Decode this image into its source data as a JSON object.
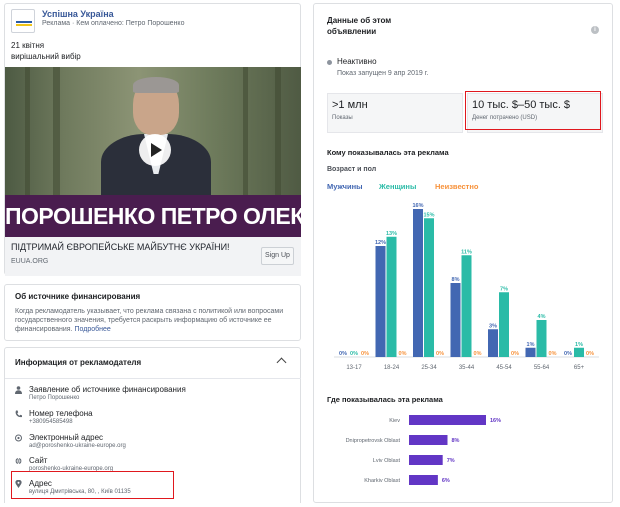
{
  "ad": {
    "page_name": "Успішна Україна",
    "sponsor_line": "Реклама · Кем оплачено: Петро Порошенко",
    "text_line1": "21 квітня",
    "text_line2": "вирішальний вибір",
    "image_banner": "ПОРОШЕНКО ПЕТРО ОЛЕКСІЙОВИЧ",
    "headline": "ПІДТРИМАЙ ЄВРОПЕЙСЬКЕ МАЙБУТНЄ УКРАЇНИ!",
    "domain": "EUUA.ORG",
    "cta_label": "Sign Up"
  },
  "funding": {
    "title": "Об источнике финансирования",
    "body": "Когда рекламодатель указывает, что реклама связана с политикой или вопросами государственного значения, требуется раскрыть информацию об источнике ее финансирования.",
    "link": "Подробнее"
  },
  "advertiser": {
    "title": "Информация от рекламодателя",
    "items": [
      {
        "icon": "person-icon",
        "label": "Заявление об источнике финансирования",
        "value": "Петро Порошенко"
      },
      {
        "icon": "phone-icon",
        "label": "Номер телефона",
        "value": "+380954585498"
      },
      {
        "icon": "email-icon",
        "label": "Электронный адрес",
        "value": "ad@poroshenko-ukraine-europe.org"
      },
      {
        "icon": "globe-icon",
        "label": "Сайт",
        "value": "poroshenko-ukraine-europe.org"
      },
      {
        "icon": "location-pin-icon",
        "label": "Адрес",
        "value": "вулиця Дмитрівська, 80, , Київ 01135"
      }
    ]
  },
  "info": {
    "title_line1": "Данные об этом",
    "title_line2": "объявлении",
    "status": "Неактивно",
    "launched": "Показ запущен 9 апр 2019 г.",
    "impressions_value": ">1 млн",
    "impressions_label": "Показы",
    "spend_value": "10 тыс. $–50 тыс. $",
    "spend_label": "Денег потрачено (USD)",
    "who_title": "Кому показывалась эта реклама",
    "age_sex_label": "Возраст и пол",
    "where_title": "Где показывалась эта реклама"
  },
  "colors": {
    "men": "#4267b2",
    "women": "#2abba7",
    "unknown": "#f7923b",
    "region_bar": "#6236c5",
    "highlight": "#e0181e"
  },
  "chart_data": [
    {
      "type": "bar",
      "categories": [
        "13-17",
        "18-24",
        "25-34",
        "35-44",
        "45-54",
        "55-64",
        "65+"
      ],
      "series": [
        {
          "name": "Мужчины",
          "values": [
            0,
            12,
            16,
            8,
            3,
            1,
            0
          ]
        },
        {
          "name": "Женщины",
          "values": [
            0,
            13,
            15,
            11,
            7,
            4,
            1
          ]
        },
        {
          "name": "Неизвестно",
          "values": [
            0,
            0,
            0,
            0,
            0,
            0,
            0
          ]
        }
      ],
      "unit": "%",
      "data_labels": [
        [
          "0%",
          "12%",
          "16%",
          "8%",
          "3%",
          "1%",
          "0%"
        ],
        [
          "0%",
          "13%",
          "15%",
          "11%",
          "7%",
          "4%",
          "1%"
        ],
        [
          "0%",
          "0%",
          "0%",
          "0%",
          "0%",
          "0%",
          "0%"
        ]
      ],
      "ylim": [
        0,
        16
      ]
    },
    {
      "type": "bar",
      "orientation": "horizontal",
      "categories": [
        "Kiev",
        "Dnipropetrovsk Oblast",
        "Lviv Oblast",
        "Kharkiv Oblast"
      ],
      "values": [
        16,
        8,
        7,
        6
      ],
      "unit": "%",
      "data_labels": [
        "16%",
        "8%",
        "7%",
        "6%"
      ]
    }
  ]
}
